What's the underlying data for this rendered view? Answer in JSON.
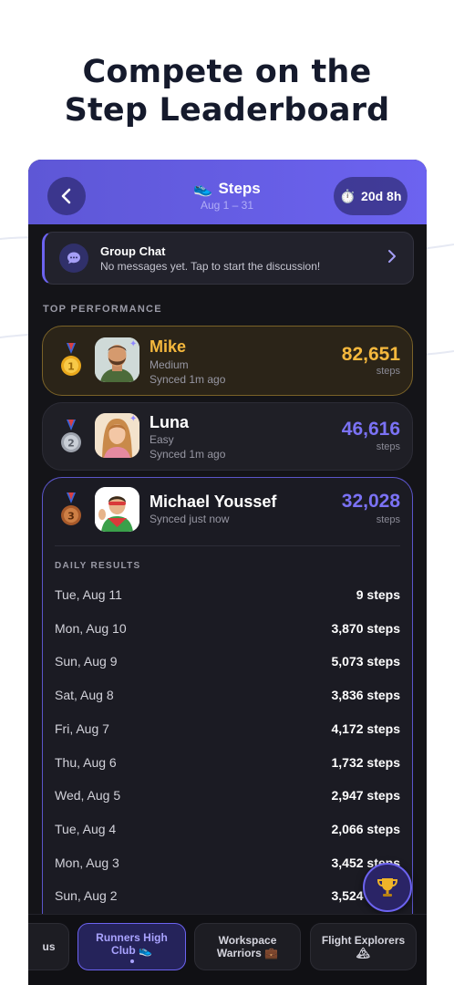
{
  "headline": {
    "line1": "Compete on the",
    "line2": "Step Leaderboard"
  },
  "header": {
    "title": "Steps",
    "title_icon": "running-shoe-icon",
    "date_range": "Aug 1 – 31",
    "timer": "20d 8h",
    "timer_icon": "stopwatch-icon"
  },
  "chat": {
    "title": "Group Chat",
    "subtitle": "No messages yet. Tap to start the discussion!"
  },
  "section_title": "TOP PERFORMANCE",
  "leaderboard": [
    {
      "rank": 1,
      "medal": "gold-medal-icon",
      "name": "Mike",
      "level": "Medium",
      "synced": "Synced 1m ago",
      "steps": "82,651",
      "unit": "steps",
      "accent": "#f5b83d"
    },
    {
      "rank": 2,
      "medal": "silver-medal-icon",
      "name": "Luna",
      "level": "Easy",
      "synced": "Synced 1m ago",
      "steps": "46,616",
      "unit": "steps",
      "accent": "#7b72f5"
    },
    {
      "rank": 3,
      "medal": "bronze-medal-icon",
      "name": "Michael Youssef",
      "synced": "Synced just now",
      "steps": "32,028",
      "unit": "steps",
      "accent": "#7b72f5"
    }
  ],
  "daily": {
    "label": "DAILY RESULTS",
    "rows": [
      {
        "date": "Tue, Aug 11",
        "steps": "9 steps"
      },
      {
        "date": "Mon, Aug 10",
        "steps": "3,870 steps"
      },
      {
        "date": "Sun, Aug 9",
        "steps": "5,073 steps"
      },
      {
        "date": "Sat, Aug 8",
        "steps": "3,836 steps"
      },
      {
        "date": "Fri, Aug 7",
        "steps": "4,172 steps"
      },
      {
        "date": "Thu, Aug 6",
        "steps": "1,732 steps"
      },
      {
        "date": "Wed, Aug 5",
        "steps": "2,947 steps"
      },
      {
        "date": "Tue, Aug 4",
        "steps": "2,066 steps"
      },
      {
        "date": "Mon, Aug 3",
        "steps": "3,452 steps"
      },
      {
        "date": "Sun, Aug 2",
        "steps": "3,524 steps"
      }
    ]
  },
  "groups": [
    {
      "label": "us",
      "active": false
    },
    {
      "label": "Runners High Club 👟",
      "active": true
    },
    {
      "label": "Workspace Warriors 💼",
      "active": false
    },
    {
      "label": "Flight Explorers 🏔",
      "active": false
    }
  ],
  "colors": {
    "accent": "#6c63f0",
    "gold": "#f5b83d",
    "background": "#141418"
  }
}
